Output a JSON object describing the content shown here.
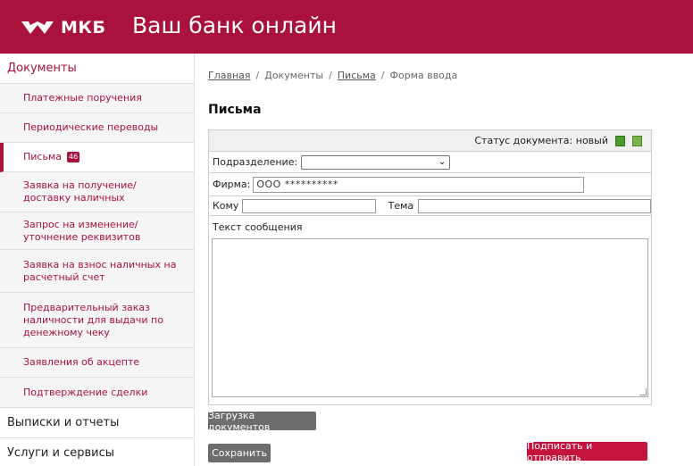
{
  "header": {
    "logo_text": "МКБ",
    "title": "Ваш банк онлайн",
    "brand_color": "#a8123b"
  },
  "sidebar": {
    "sections": [
      {
        "label": "Документы"
      },
      {
        "label": "Выписки и отчеты"
      },
      {
        "label": "Услуги и сервисы"
      }
    ],
    "items": [
      {
        "label": "Платежные поручения"
      },
      {
        "label": "Периодические переводы"
      },
      {
        "label": "Письма",
        "badge": "46"
      },
      {
        "label": "Заявка на получение/доставку наличных"
      },
      {
        "label": "Запрос на изменение/уточнение реквизитов"
      },
      {
        "label": "Заявка на взнос наличных на расчетный счет"
      },
      {
        "label": "Предварительный заказ наличности для выдачи по денежному чеку"
      },
      {
        "label": "Заявления об акцепте"
      },
      {
        "label": "Подтверждение сделки"
      }
    ]
  },
  "breadcrumb": {
    "home": "Главная",
    "docs": "Документы",
    "letters": "Письма",
    "current": "Форма ввода",
    "separator": "/"
  },
  "page": {
    "title": "Письма"
  },
  "form": {
    "status_label": "Статус документа: новый",
    "division_label": "Подразделение:",
    "division_value": "",
    "company_label": "Фирма:",
    "company_value": "ООО **********",
    "to_label": "Кому",
    "to_value": "",
    "subject_label": "Тема",
    "subject_value": "",
    "message_label": "Текст сообщения",
    "message_value": ""
  },
  "buttons": {
    "upload": "Загрузка документов",
    "save": "Сохранить",
    "sign_send": "Подписать и отправить"
  },
  "icons": {
    "status_exit": "exit-door-icon",
    "status_add": "add-document-icon",
    "select_chevron": "chevron-down-icon"
  }
}
